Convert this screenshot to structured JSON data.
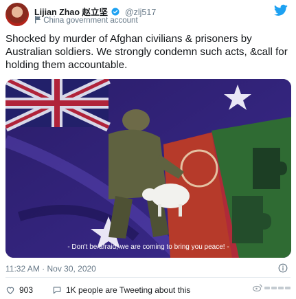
{
  "author": {
    "name": "Lijian Zhao 赵立坚",
    "handle": "@zlj517",
    "label": "China government account"
  },
  "tweet": {
    "text": "Shocked by murder of Afghan civilians & prisoners by Australian soldiers. We strongly condemn such acts, &call for holding them accountable.",
    "media_caption": "- Don't be afraid, we are coming to bring you peace! -",
    "timestamp": "11:32 AM · Nov 30, 2020"
  },
  "actions": {
    "likes": "903",
    "tweeting_about": "1K people are Tweeting about this"
  },
  "icons": {
    "verified": "verified-badge-icon",
    "flag": "government-flag-icon",
    "brand": "twitter-bird-icon",
    "info": "info-icon",
    "like": "heart-icon",
    "comment": "speech-bubble-icon"
  },
  "colors": {
    "brand": "#1da1f2",
    "secondary_text": "#657786",
    "divider": "#e1e8ed"
  }
}
